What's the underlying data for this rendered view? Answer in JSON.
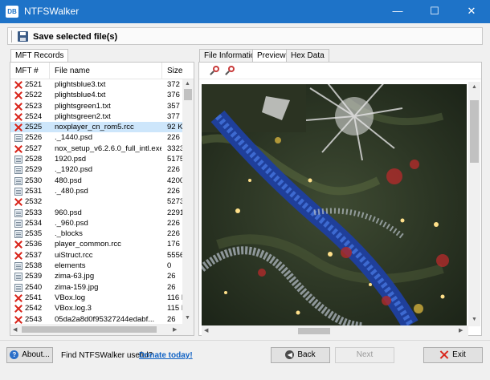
{
  "window": {
    "app_icon_text": "DB",
    "title": "NTFSWalker",
    "min_glyph": "—",
    "max_glyph": "☐",
    "close_glyph": "✕"
  },
  "toolbar": {
    "save_label": "Save selected file(s)"
  },
  "left_tab": {
    "label": "MFT Records"
  },
  "right_tabs": [
    "File Information",
    "Preview",
    "Hex Data"
  ],
  "active_right_tab": "Preview",
  "columns": {
    "mft": "MFT #",
    "name": "File name",
    "size": "Size"
  },
  "rows": [
    {
      "icon": "deleted",
      "mft": "2521",
      "name": "plightsblue3.txt",
      "size": "372"
    },
    {
      "icon": "deleted",
      "mft": "2522",
      "name": "plightsblue4.txt",
      "size": "376"
    },
    {
      "icon": "deleted",
      "mft": "2523",
      "name": "plightsgreen1.txt",
      "size": "357"
    },
    {
      "icon": "deleted",
      "mft": "2524",
      "name": "plightsgreen2.txt",
      "size": "377"
    },
    {
      "icon": "deleted",
      "mft": "2525",
      "name": "noxplayer_cn_rom5.rcc",
      "size": "92 K",
      "selected": true
    },
    {
      "icon": "file",
      "mft": "2526",
      "name": "._1440.psd",
      "size": "226"
    },
    {
      "icon": "deleted",
      "mft": "2527",
      "name": "nox_setup_v6.2.6.0_full_intl.exe",
      "size": "3323"
    },
    {
      "icon": "file",
      "mft": "2528",
      "name": "1920.psd",
      "size": "5175"
    },
    {
      "icon": "file",
      "mft": "2529",
      "name": "._1920.psd",
      "size": "226"
    },
    {
      "icon": "file",
      "mft": "2530",
      "name": "480.psd",
      "size": "4200"
    },
    {
      "icon": "file",
      "mft": "2531",
      "name": "._480.psd",
      "size": "226"
    },
    {
      "icon": "deleted",
      "mft": "2532",
      "name": "",
      "size": "5273"
    },
    {
      "icon": "file",
      "mft": "2533",
      "name": "960.psd",
      "size": "2291"
    },
    {
      "icon": "file",
      "mft": "2534",
      "name": "._960.psd",
      "size": "226"
    },
    {
      "icon": "file",
      "mft": "2535",
      "name": "._blocks",
      "size": "226"
    },
    {
      "icon": "deleted",
      "mft": "2536",
      "name": "player_common.rcc",
      "size": "176"
    },
    {
      "icon": "deleted",
      "mft": "2537",
      "name": "uiStruct.rcc",
      "size": "5556"
    },
    {
      "icon": "file",
      "mft": "2538",
      "name": "elements",
      "size": "0"
    },
    {
      "icon": "file",
      "mft": "2539",
      "name": "zima-63.jpg",
      "size": "26"
    },
    {
      "icon": "file",
      "mft": "2540",
      "name": "zima-159.jpg",
      "size": "26"
    },
    {
      "icon": "deleted",
      "mft": "2541",
      "name": "VBox.log",
      "size": "116 I"
    },
    {
      "icon": "deleted",
      "mft": "2542",
      "name": "VBox.log.3",
      "size": "115 I"
    },
    {
      "icon": "deleted",
      "mft": "2543",
      "name": "05da2a8d0f95327244edabf...",
      "size": "26"
    }
  ],
  "footer": {
    "about_label": "About...",
    "promo_text": "Find NTFSWalker useful?",
    "promo_link": "Donate today!",
    "back_label": "Back",
    "next_label": "Next",
    "exit_label": "Exit"
  }
}
